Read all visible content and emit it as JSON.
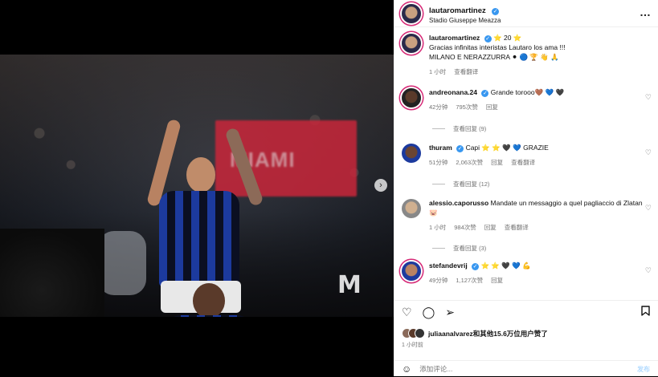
{
  "post": {
    "author": "lautaromartinez",
    "location": "Stadio Giuseppe Meazza",
    "more_icon": "…",
    "caption_line1": "Gracias infinitas interistas Lautaro los ama !!!",
    "caption_line2": "MILANO E NERAZZURRA ⚫ 🔵 🏆 👋 🙏",
    "caption_badge": "⭐ 20 ⭐",
    "caption_time": "1 小时",
    "caption_translate": "查看翻译"
  },
  "media": {
    "banner_text": "MIAMI",
    "watermark": "M"
  },
  "comments": [
    {
      "user": "andreonana.24",
      "verified": true,
      "text": "Grande torooo🤎 💙 🖤",
      "time": "42分钟",
      "likes": "795次赞",
      "reply": "回复",
      "translate": "",
      "replies": "查看回复 (9)"
    },
    {
      "user": "thuram",
      "verified": true,
      "text": "Capi ⭐ ⭐ 🖤 💙 GRAZIE",
      "time": "51分钟",
      "likes": "2,063次赞",
      "reply": "回复",
      "translate": "查看翻译",
      "replies": "查看回复 (12)"
    },
    {
      "user": "alessio.caporusso",
      "verified": false,
      "text": "Mandate un messaggio a quel pagliaccio di Zlatan 🐷",
      "time": "1 小时",
      "likes": "984次赞",
      "reply": "回复",
      "translate": "查看翻译",
      "replies": "查看回复 (3)"
    },
    {
      "user": "stefandevrij",
      "verified": true,
      "text": "⭐ ⭐ 🖤 💙 💪",
      "time": "49分钟",
      "likes": "1,127次赞",
      "reply": "回复",
      "translate": "",
      "replies": ""
    }
  ],
  "footer": {
    "likes_text": "juliaanalvarez和其他15.6万位用户赞了",
    "time": "1 小时前",
    "comment_placeholder": "添加评论...",
    "post_button": "发布"
  },
  "colors": {
    "accent": "#3897f0",
    "story_ring": "#d62976"
  }
}
